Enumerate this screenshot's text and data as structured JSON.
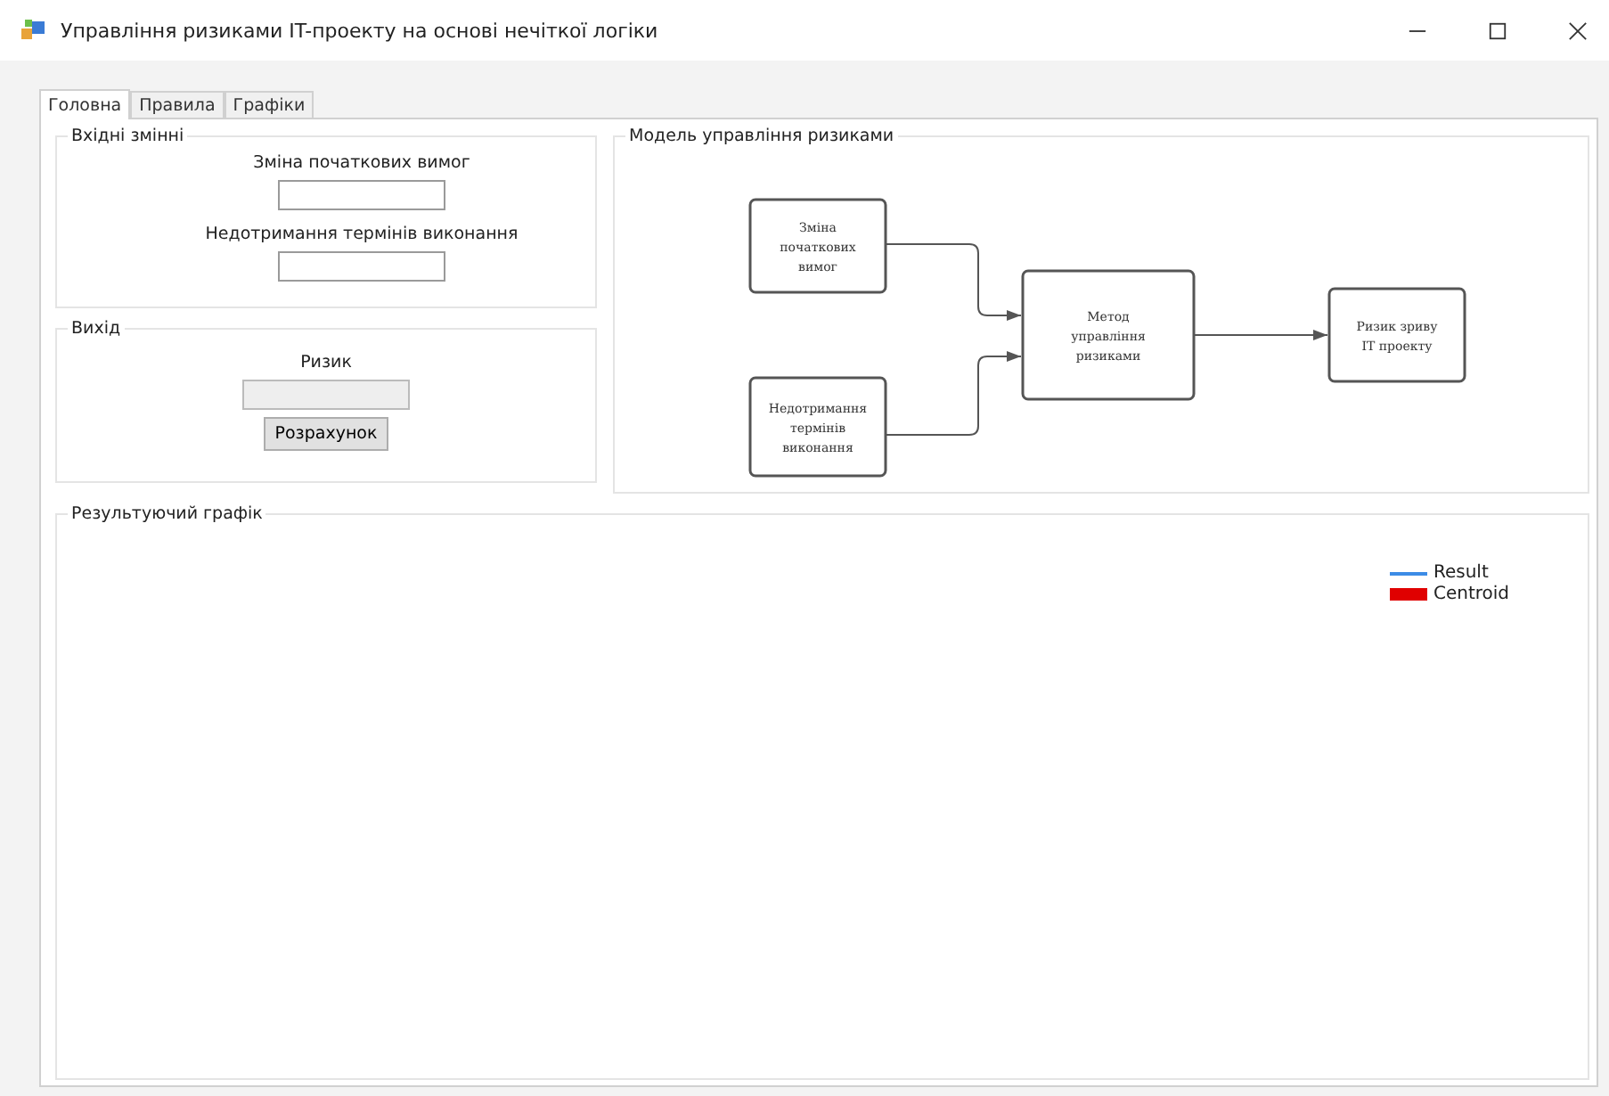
{
  "window": {
    "title": "Управління ризиками IT-проекту на основі нечіткої логіки"
  },
  "tabs": [
    {
      "label": "Головна",
      "selected": true
    },
    {
      "label": "Правила",
      "selected": false
    },
    {
      "label": "Графіки",
      "selected": false
    }
  ],
  "inputs": {
    "title": "Вхідні змінні",
    "fields": [
      {
        "label": "Зміна початкових вимог"
      },
      {
        "label": "Недотримання термінів виконання"
      }
    ]
  },
  "output": {
    "title": "Вихід",
    "label": "Ризик",
    "disabled": true,
    "button": "Розрахунок"
  },
  "model": {
    "title": "Модель управління ризиками",
    "nodes": [
      [
        "Зміна",
        "початкових",
        "вимог"
      ],
      [
        "Недотримання",
        "термінів",
        "виконання"
      ],
      [
        "Метод",
        "управління",
        "ризиками"
      ],
      [
        "Ризик зриву",
        "ІТ проекту"
      ]
    ]
  },
  "result": {
    "title": "Результуючий графік",
    "legend": [
      {
        "label": "Result",
        "kind": "line",
        "color": "#3c8ce6"
      },
      {
        "label": "Centroid",
        "kind": "block",
        "color": "#e00000"
      }
    ]
  }
}
